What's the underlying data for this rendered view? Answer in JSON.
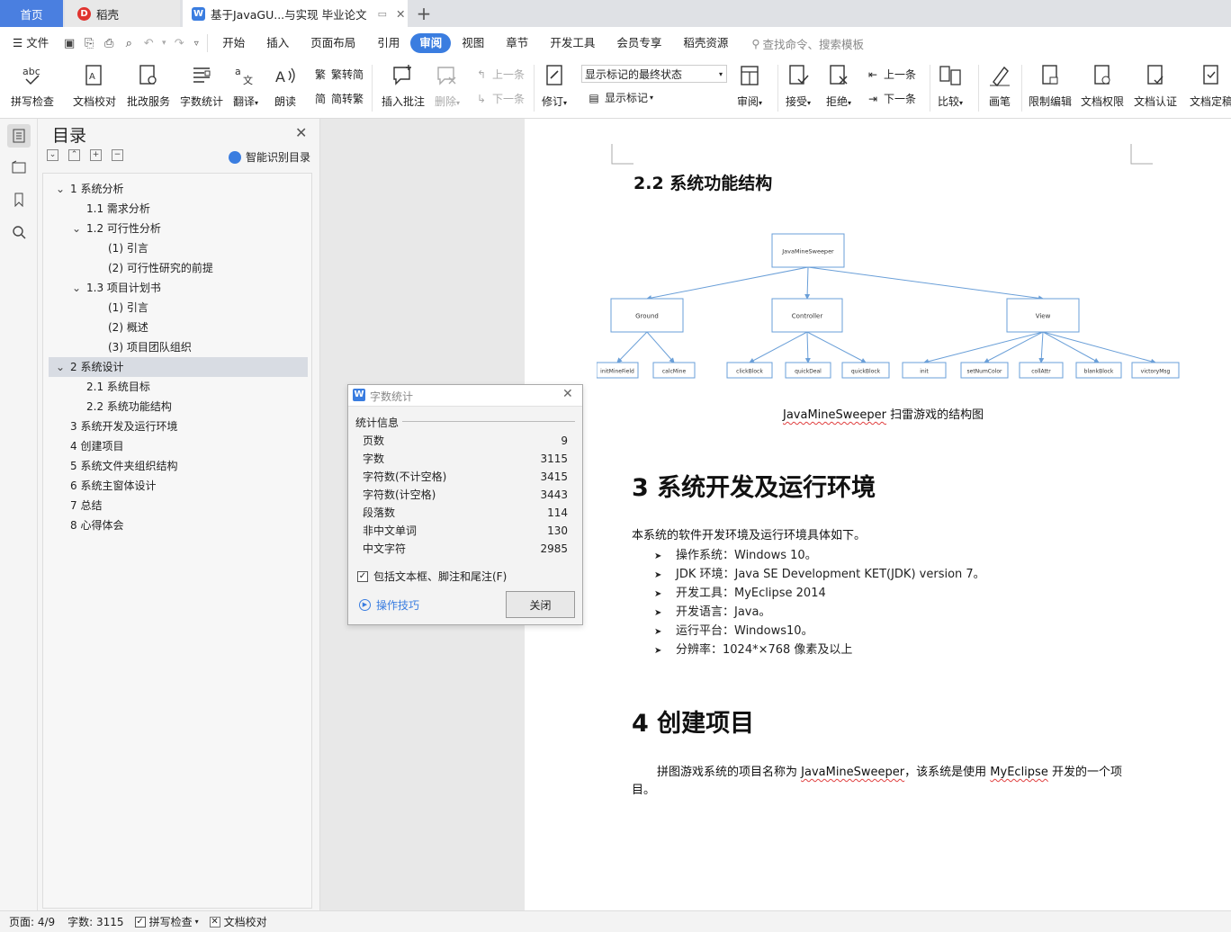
{
  "tabs": {
    "home": "首页",
    "daoke": "稻壳",
    "doc": "基于JavaGU...与实现 毕业论文"
  },
  "menu": {
    "file": "文件",
    "items": [
      "开始",
      "插入",
      "页面布局",
      "引用",
      "审阅",
      "视图",
      "章节",
      "开发工具",
      "会员专享",
      "稻壳资源"
    ],
    "active_index": 4,
    "search": "查找命令、搜索模板"
  },
  "ribbon": {
    "spellcheck": "拼写检查",
    "proofread": "文档校对",
    "revise_service": "批改服务",
    "word_count": "字数统计",
    "translate": "翻译",
    "read_aloud": "朗读",
    "trad": "繁转简",
    "simp": "简转繁",
    "insert_comment": "插入批注",
    "delete": "删除",
    "prev_comment": "上一条",
    "next_comment": "下一条",
    "track": "修订",
    "markup_state": "显示标记的最终状态",
    "show_markup": "显示标记",
    "review": "审阅",
    "accept": "接受",
    "reject": "拒绝",
    "prev_change": "上一条",
    "next_change": "下一条",
    "compare": "比较",
    "pen": "画笔",
    "restrict": "限制编辑",
    "permission": "文档权限",
    "certify": "文档认证",
    "finalize": "文档定稿"
  },
  "toc": {
    "title": "目录",
    "smart": "智能识别目录",
    "items": [
      {
        "text": "1 系统分析"
      },
      {
        "text": "1.1 需求分析"
      },
      {
        "text": "1.2 可行性分析"
      },
      {
        "text": "(1)  引言"
      },
      {
        "text": "(2)  可行性研究的前提"
      },
      {
        "text": "1.3 项目计划书"
      },
      {
        "text": "(1)  引言"
      },
      {
        "text": "(2)  概述"
      },
      {
        "text": "(3)  项目团队组织"
      },
      {
        "text": "2 系统设计"
      },
      {
        "text": "2.1 系统目标"
      },
      {
        "text": "2.2 系统功能结构"
      },
      {
        "text": "3 系统开发及运行环境"
      },
      {
        "text": "4 创建项目"
      },
      {
        "text": "5 系统文件夹组织结构"
      },
      {
        "text": "6 系统主窗体设计"
      },
      {
        "text": "7 总结"
      },
      {
        "text": "8 心得体会"
      }
    ]
  },
  "doc": {
    "h_22": "2.2 系统功能结构",
    "diagram": {
      "root": "JavaMineSweeper",
      "mid": [
        "Ground",
        "Controller",
        "View"
      ],
      "leaves": [
        "initMineField",
        "calcMine",
        "clickBlock",
        "quickDeal",
        "quickBlock",
        "init",
        "setNumColor",
        "collAttr",
        "blankBlock",
        "victoryMsg"
      ]
    },
    "caption_a": "JavaMineSweeper",
    "caption_b": " 扫雷游戏的结构图",
    "h_3": "3 系统开发及运行环境",
    "p_env": "本系统的软件开发环境及运行环境具体如下。",
    "bullets": [
      "操作系统：Windows 10。",
      "JDK 环境：Java SE Development KET(JDK) version 7。",
      "开发工具：MyEclipse 2014",
      "开发语言：Java。",
      "运行平台：Windows10。",
      "分辨率：1024*×768 像素及以上"
    ],
    "h_4": "4 创建项目",
    "p_proj_a": "拼图游戏系统的项目名称为 ",
    "p_proj_b": "JavaMineSweeper",
    "p_proj_c": "，该系统是使用 ",
    "p_proj_d": "MyEclipse",
    "p_proj_e": " 开发的一个项",
    "p_proj_f": "目。"
  },
  "dialog": {
    "title": "字数统计",
    "group": "统计信息",
    "stats": [
      {
        "label": "页数",
        "value": "9"
      },
      {
        "label": "字数",
        "value": "3115"
      },
      {
        "label": "字符数(不计空格)",
        "value": "3415"
      },
      {
        "label": "字符数(计空格)",
        "value": "3443"
      },
      {
        "label": "段落数",
        "value": "114"
      },
      {
        "label": "非中文单词",
        "value": "130"
      },
      {
        "label": "中文字符",
        "value": "2985"
      }
    ],
    "include": "包括文本框、脚注和尾注(F)",
    "tips": "操作技巧",
    "close": "关闭"
  },
  "status": {
    "page": "页面: 4/9",
    "words": "字数: 3115",
    "spell": "拼写检查",
    "proof": "文档校对"
  },
  "colors": {
    "accent": "#3a7de0",
    "diagram_line": "#6a9fd8"
  }
}
